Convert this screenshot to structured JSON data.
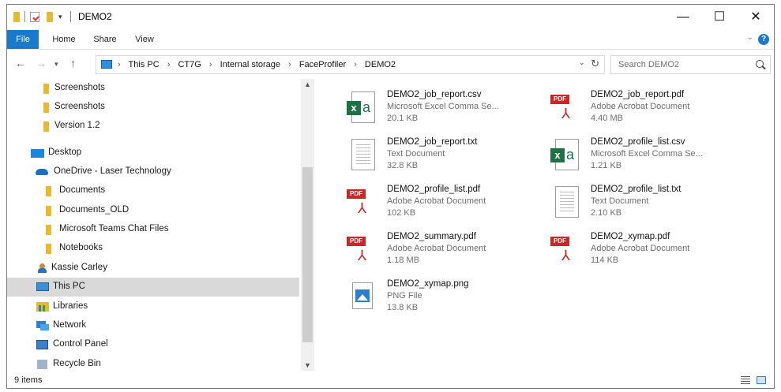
{
  "window": {
    "title": "DEMO2",
    "controls": {
      "minimize": "—",
      "maximize": "☐",
      "close": "✕"
    }
  },
  "ribbon": {
    "tabs": [
      "File",
      "Home",
      "Share",
      "View"
    ],
    "help": "?"
  },
  "address": {
    "breadcrumbs": [
      "This PC",
      "CT7G",
      "Internal storage",
      "FaceProfiler",
      "DEMO2"
    ],
    "search_placeholder": "Search DEMO2"
  },
  "nav_pane": {
    "items": [
      {
        "label": "Screenshots",
        "icon": "folder-icon"
      },
      {
        "label": "Screenshots",
        "icon": "folder-icon"
      },
      {
        "label": "Version 1.2",
        "icon": "folder-icon"
      },
      {
        "label": "Desktop",
        "icon": "desktop-icon"
      },
      {
        "label": "OneDrive - Laser Technology",
        "icon": "onedrive-cloud-icon"
      },
      {
        "label": "Documents",
        "icon": "folder-icon"
      },
      {
        "label": "Documents_OLD",
        "icon": "folder-icon"
      },
      {
        "label": "Microsoft Teams Chat Files",
        "icon": "folder-icon"
      },
      {
        "label": "Notebooks",
        "icon": "folder-icon"
      },
      {
        "label": "Kassie Carley",
        "icon": "user-icon"
      },
      {
        "label": "This PC",
        "icon": "pc-icon",
        "selected": true
      },
      {
        "label": "Libraries",
        "icon": "libraries-icon"
      },
      {
        "label": "Network",
        "icon": "network-icon"
      },
      {
        "label": "Control Panel",
        "icon": "control-panel-icon"
      },
      {
        "label": "Recycle Bin",
        "icon": "recycle-bin-icon"
      }
    ]
  },
  "files": [
    {
      "name": "DEMO2_job_report.csv",
      "type": "Microsoft Excel Comma Se...",
      "size": "20.1 KB",
      "icon": "excel-csv-icon"
    },
    {
      "name": "DEMO2_job_report.pdf",
      "type": "Adobe Acrobat Document",
      "size": "4.40 MB",
      "icon": "pdf-icon"
    },
    {
      "name": "DEMO2_job_report.txt",
      "type": "Text Document",
      "size": "32.8 KB",
      "icon": "text-document-icon"
    },
    {
      "name": "DEMO2_profile_list.csv",
      "type": "Microsoft Excel Comma Se...",
      "size": "1.21 KB",
      "icon": "excel-csv-icon"
    },
    {
      "name": "DEMO2_profile_list.pdf",
      "type": "Adobe Acrobat Document",
      "size": "102 KB",
      "icon": "pdf-icon"
    },
    {
      "name": "DEMO2_profile_list.txt",
      "type": "Text Document",
      "size": "2.10 KB",
      "icon": "text-document-icon"
    },
    {
      "name": "DEMO2_summary.pdf",
      "type": "Adobe Acrobat Document",
      "size": "1.18 MB",
      "icon": "pdf-icon"
    },
    {
      "name": "DEMO2_xymap.pdf",
      "type": "Adobe Acrobat Document",
      "size": "114 KB",
      "icon": "pdf-icon"
    },
    {
      "name": "DEMO2_xymap.png",
      "type": "PNG File",
      "size": "13.8 KB",
      "icon": "png-image-icon"
    }
  ],
  "status": {
    "count": "9 items"
  },
  "icon_glyphs": {
    "pdf_badge": "PDF",
    "excel_x": "x",
    "excel_a": "a",
    "acrobat": "⅄"
  },
  "colors": {
    "accent": "#1979ca",
    "selection": "#d9d9d9",
    "excel": "#1e7145",
    "pdf": "#c62828",
    "folder": "#e8b830"
  }
}
